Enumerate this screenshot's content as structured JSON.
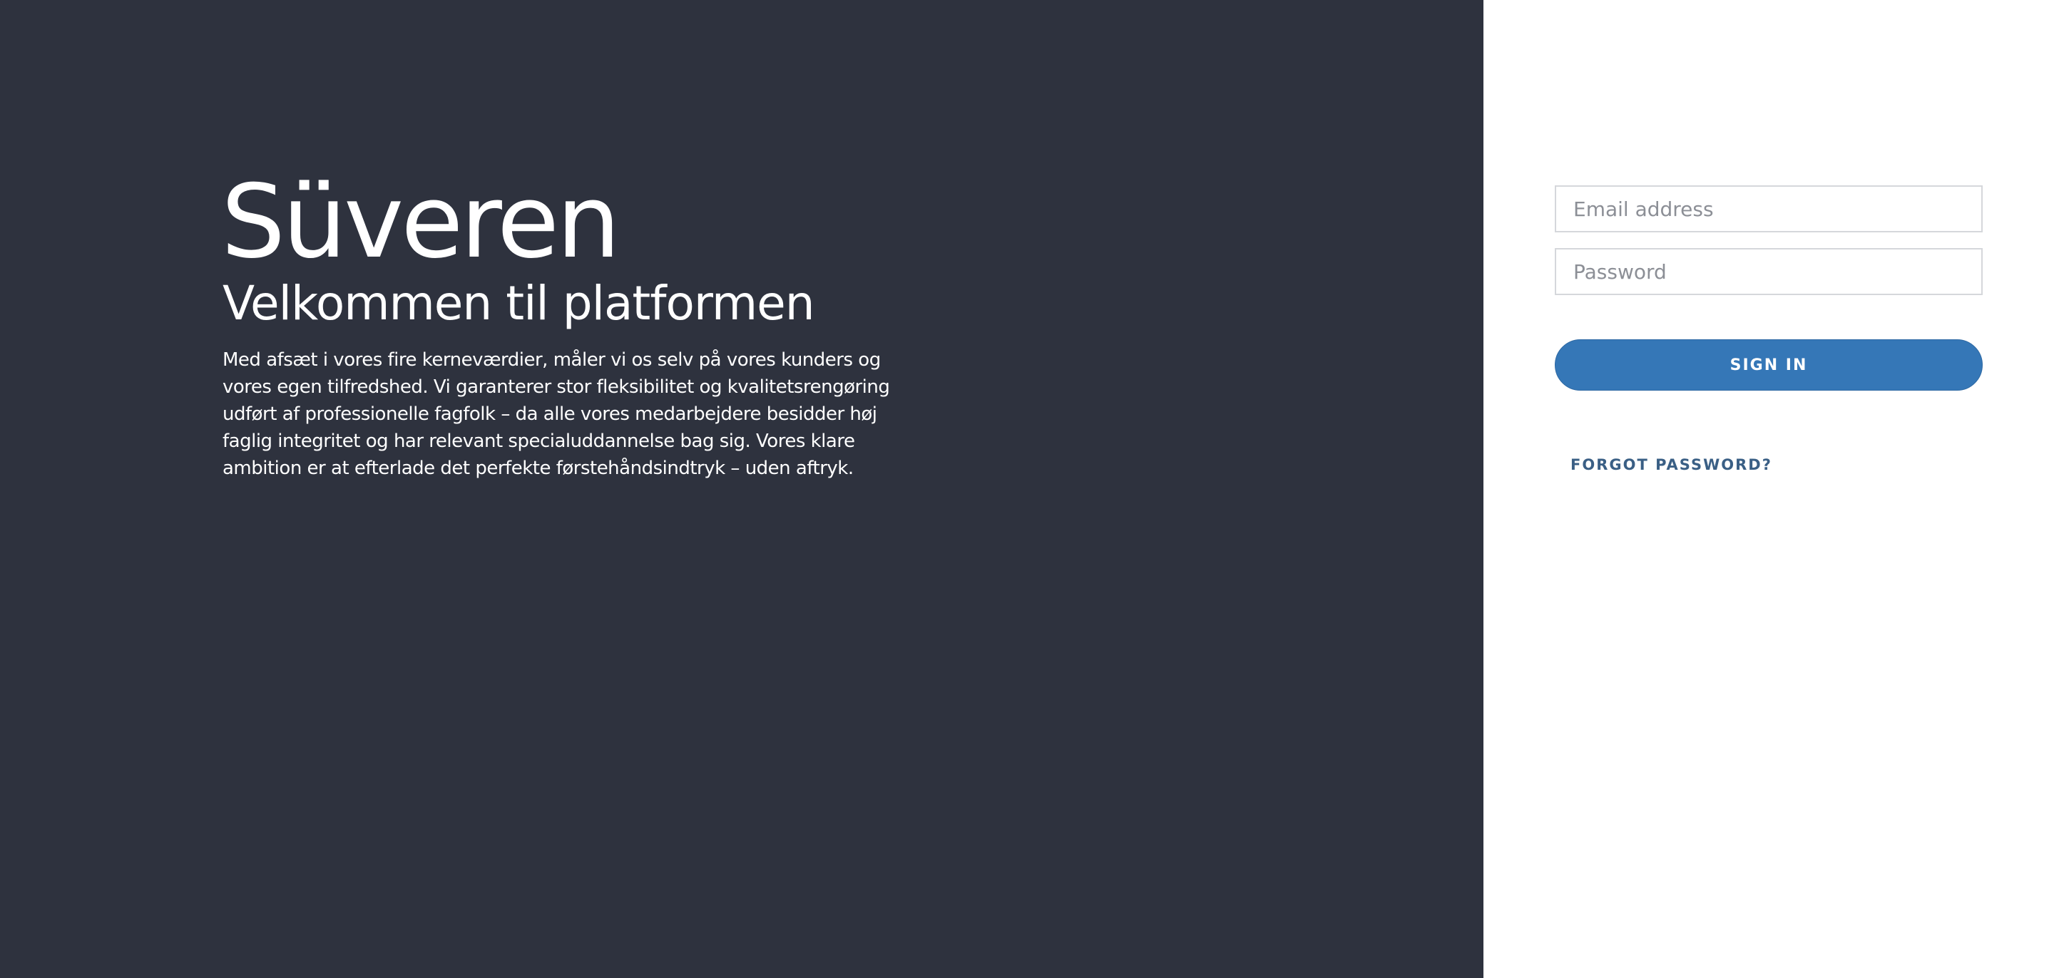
{
  "brand": {
    "logo_text": "Süveren"
  },
  "hero": {
    "title": "Velkommen til platformen",
    "description": "Med afsæt i vores fire kerneværdier, måler vi os selv på vores kunders og vores egen tilfredshed. Vi garanterer stor fleksibilitet og kvalitetsrengøring udført af professionelle fagfolk – da alle vores medarbejdere besidder høj faglig integritet og har relevant specialuddannelse bag sig. Vores klare ambition er at efterlade det perfekte førstehåndsindtryk – uden aftryk."
  },
  "login": {
    "email": {
      "placeholder": "Email address",
      "value": ""
    },
    "password": {
      "placeholder": "Password",
      "value": ""
    },
    "sign_in_label": "SIGN IN",
    "forgot_label": "FORGOT PASSWORD?"
  },
  "colors": {
    "left_panel_bg": "#2e323e",
    "right_panel_bg": "#ffffff",
    "primary_button": "#3577b7",
    "link": "#3a5f85",
    "input_border": "#d5d7db"
  }
}
